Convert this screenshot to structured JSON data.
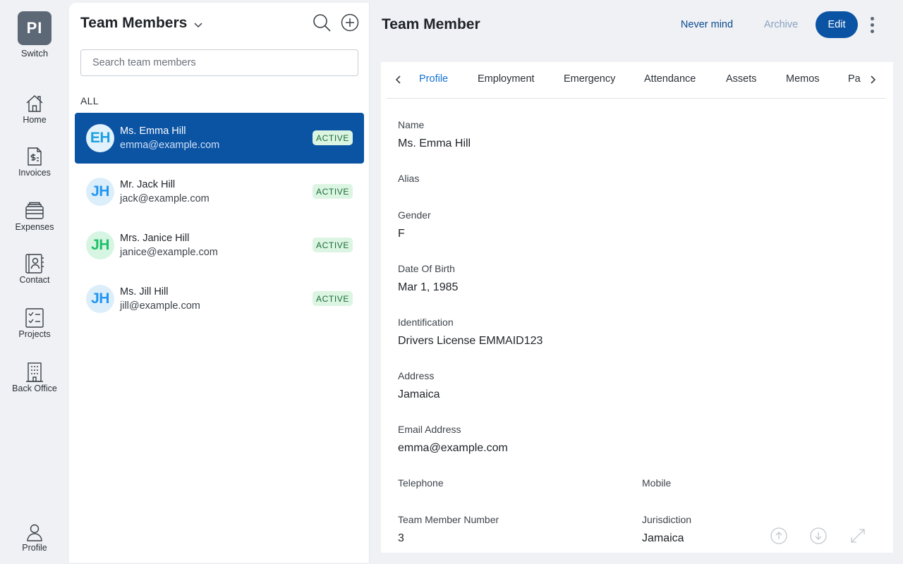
{
  "rail": {
    "switch_initials": "PI",
    "switch_label": "Switch",
    "items": [
      {
        "label": "Home",
        "icon": "home-icon"
      },
      {
        "label": "Invoices",
        "icon": "invoice-icon"
      },
      {
        "label": "Expenses",
        "icon": "wallet-icon"
      },
      {
        "label": "Contact",
        "icon": "contact-book-icon"
      },
      {
        "label": "Projects",
        "icon": "checklist-icon"
      },
      {
        "label": "Back Office",
        "icon": "building-icon"
      }
    ],
    "profile_label": "Profile"
  },
  "list": {
    "title": "Team Members",
    "search_placeholder": "Search team members",
    "section_label": "ALL",
    "members": [
      {
        "initials": "EH",
        "name": "Ms. Emma Hill",
        "email": "emma@example.com",
        "status": "ACTIVE",
        "avatar_bg": "#e1f2fd",
        "avatar_fg": "#1ea0e0"
      },
      {
        "initials": "JH",
        "name": "Mr. Jack Hill",
        "email": "jack@example.com",
        "status": "ACTIVE",
        "avatar_bg": "#ddeefb",
        "avatar_fg": "#2196f3"
      },
      {
        "initials": "JH",
        "name": "Mrs. Janice Hill",
        "email": "janice@example.com",
        "status": "ACTIVE",
        "avatar_bg": "#d6f5e2",
        "avatar_fg": "#1ec06a"
      },
      {
        "initials": "JH",
        "name": "Ms. Jill Hill",
        "email": "jill@example.com",
        "status": "ACTIVE",
        "avatar_bg": "#ddeefb",
        "avatar_fg": "#2196f3"
      }
    ]
  },
  "detail": {
    "title": "Team Member",
    "never_mind": "Never mind",
    "archive": "Archive",
    "edit": "Edit",
    "tabs": [
      "Profile",
      "Employment",
      "Emergency",
      "Attendance",
      "Assets",
      "Memos",
      "Pa"
    ],
    "active_tab": "Profile",
    "fields": {
      "name": {
        "label": "Name",
        "value": "Ms. Emma Hill"
      },
      "alias": {
        "label": "Alias",
        "value": ""
      },
      "gender": {
        "label": "Gender",
        "value": "F"
      },
      "dob": {
        "label": "Date Of Birth",
        "value": "Mar 1, 1985"
      },
      "identification": {
        "label": "Identification",
        "value": "Drivers License EMMAID123"
      },
      "address": {
        "label": "Address",
        "value": "Jamaica"
      },
      "email": {
        "label": "Email Address",
        "value": "emma@example.com"
      },
      "telephone": {
        "label": "Telephone",
        "value": ""
      },
      "mobile": {
        "label": "Mobile",
        "value": ""
      },
      "member_number": {
        "label": "Team Member Number",
        "value": "3"
      },
      "jurisdiction": {
        "label": "Jurisdiction",
        "value": "Jamaica"
      }
    }
  },
  "colors": {
    "accent": "#0b54a4",
    "tab_active": "#1372d3",
    "badge_bg": "#dcf5e3",
    "badge_fg": "#1a6b35"
  }
}
